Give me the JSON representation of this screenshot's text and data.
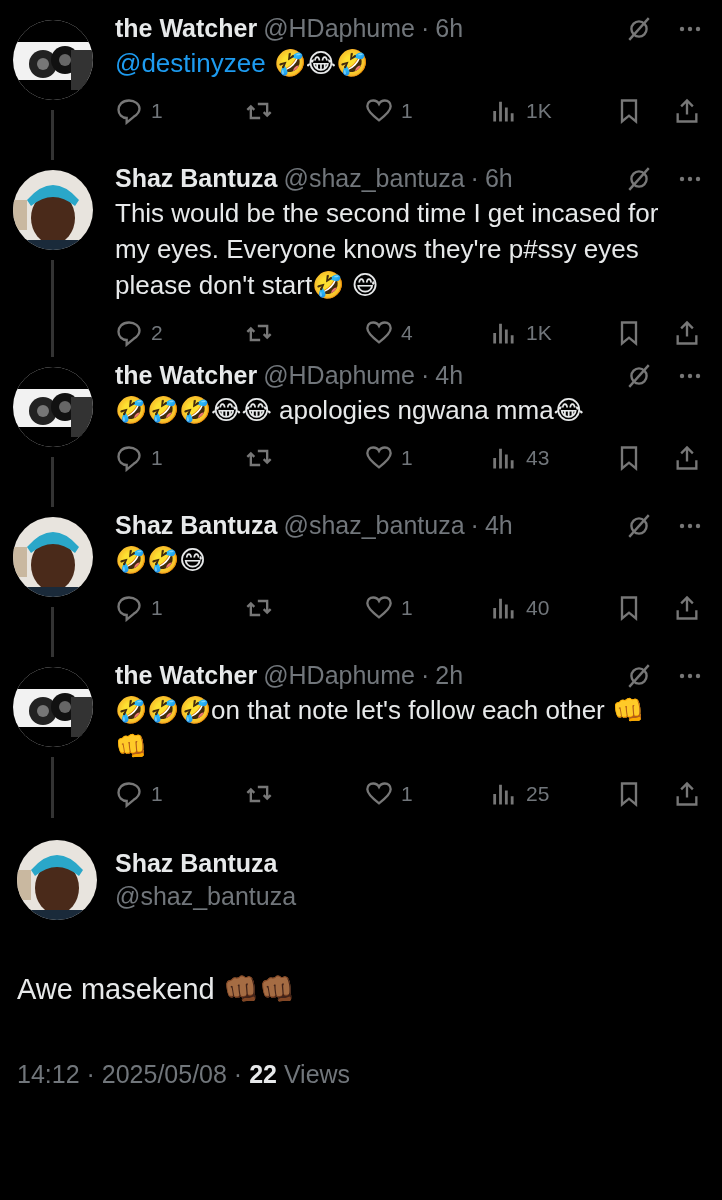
{
  "replies": [
    {
      "name": "the Watcher",
      "handle": "@HDaphume",
      "separator": "·",
      "time": "6h",
      "mention": "@destinyzee",
      "text": "🤣😂🤣",
      "replies": "1",
      "likes": "1",
      "views": "1K"
    },
    {
      "name": "Shaz Bantuza",
      "handle": "@shaz_bantuza",
      "separator": "·",
      "time": "6h",
      "text": "This would be the second time I get incased for my eyes. Everyone knows they're p#ssy eyes please don't start🤣 😅",
      "replies": "2",
      "likes": "4",
      "views": "1K"
    },
    {
      "name": "the Watcher",
      "handle": "@HDaphume",
      "separator": "·",
      "time": "4h",
      "text": "🤣🤣🤣😂😂 apologies ngwana mma😂",
      "replies": "1",
      "likes": "1",
      "views": "43"
    },
    {
      "name": "Shaz Bantuza",
      "handle": "@shaz_bantuza",
      "separator": "·",
      "time": "4h",
      "text": "🤣🤣😅",
      "replies": "1",
      "likes": "1",
      "views": "40"
    },
    {
      "name": "the Watcher",
      "handle": "@HDaphume",
      "separator": "·",
      "time": "2h",
      "text": "🤣🤣🤣on that note let's follow each other 👊👊",
      "replies": "1",
      "likes": "1",
      "views": "25"
    }
  ],
  "main": {
    "name": "Shaz Bantuza",
    "handle": "@shaz_bantuza",
    "text": "Awe masekend 👊🏾👊🏾",
    "footer": "14:12 · 2025/05/08 · **22** Views"
  }
}
